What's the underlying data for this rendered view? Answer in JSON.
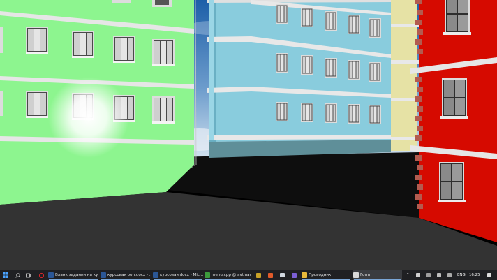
{
  "scene": {
    "type": "3d-render",
    "colors": {
      "sky_top": "#1d5fa8",
      "sky_bottom": "#d5e4f0",
      "green_building": "#8df58f",
      "blue_building": "#89ccdd",
      "yellow_building": "#e6e2a5",
      "red_building": "#d60a00",
      "ground": "#333333",
      "back_ground": "#0e0e0e",
      "ledge": "#e6e6e6"
    }
  },
  "taskbar": {
    "start_icon": "windows-logo",
    "apps": [
      {
        "label": "Бланк задания на ку...",
        "icon": "word-icon",
        "color": "#2b5797"
      },
      {
        "label": "курсовая ооп.docx - ...",
        "icon": "word-icon",
        "color": "#2b5797"
      },
      {
        "label": "курсовая.docx - Micr...",
        "icon": "word-icon",
        "color": "#2b5797"
      },
      {
        "label": "menu.cpp @ avtinar_...",
        "icon": "editor-icon",
        "color": "#3c9a3c"
      },
      {
        "label": "Проводник",
        "icon": "folder-icon",
        "color": "#e8b93b"
      },
      {
        "label": "Form",
        "icon": "form-icon",
        "color": "#d8d8d8"
      }
    ],
    "tray": {
      "language": "ENG",
      "time": "16:25"
    }
  }
}
